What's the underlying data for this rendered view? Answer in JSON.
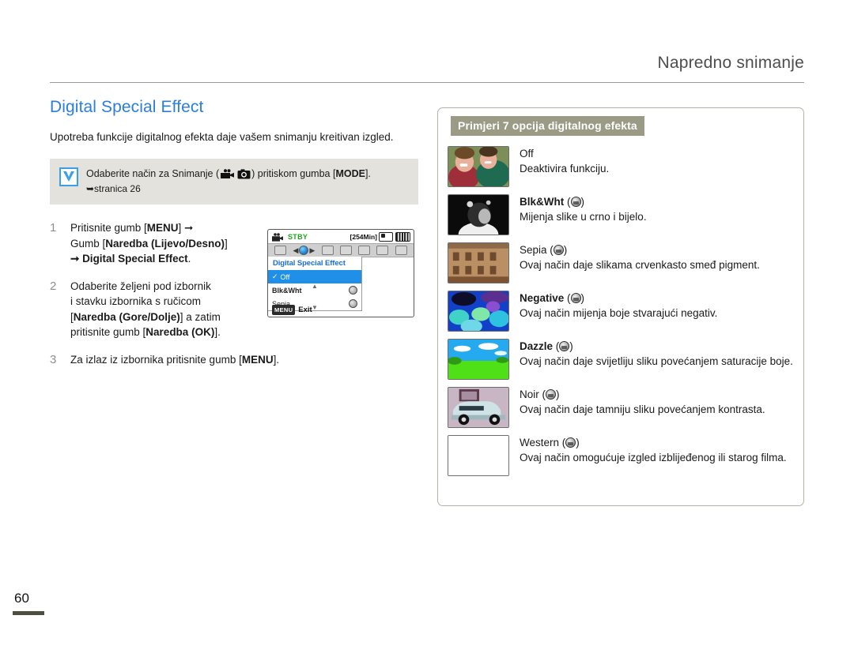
{
  "header": {
    "chapter": "Napredno snimanje"
  },
  "section": {
    "title": "Digital Special Effect",
    "intro": "Upotreba funkcije digitalnog efekta daje vašem snimanju kreitivan izgled."
  },
  "note": {
    "icon": "checkbox-checked-icon",
    "text_before": "Odaberite način za Snimanje (",
    "icon_camcorder": "camcorder-icon",
    "icon_photo": "photo-camera-icon",
    "text_after": ") pritiskom gumba [",
    "button": "MODE",
    "text_end": "].",
    "page_ref": "➥stranica 26"
  },
  "steps": [
    {
      "num": "1",
      "line1_a": "Pritisnite gumb [",
      "line1_b": "MENU",
      "line1_c": "] ➞",
      "line2_a": "Gumb [",
      "line2_b": "Naredba (Lijevo/Desno)",
      "line2_c": "]",
      "line3_a": "➞ ",
      "line3_b": "Digital Special Effect",
      "line3_c": "."
    },
    {
      "num": "2",
      "line1": "Odaberite željeni pod izbornik",
      "line2": "i stavku izbornika s ručicom",
      "line3_a": "[",
      "line3_b": "Naredba (Gore/Dolje)",
      "line3_c": "] a zatim",
      "line4_a": "pritisnite gumb [",
      "line4_b": "Naredba (OK)",
      "line4_c": "]."
    },
    {
      "num": "3",
      "line1_a": "Za izlaz iz izbornika pritisnite gumb [",
      "line1_b": "MENU",
      "line1_c": "]."
    }
  ],
  "lcd": {
    "status": "STBY",
    "remaining": "[254Min]",
    "menu_title": "Digital Special Effect",
    "rows": [
      {
        "label": "Off",
        "selected": true,
        "checked": true,
        "has_icon": false
      },
      {
        "label": "Blk&Wht",
        "selected": false,
        "checked": false,
        "has_icon": true
      },
      {
        "label": "Sepia",
        "selected": false,
        "checked": false,
        "has_icon": true
      }
    ],
    "exit_button": "MENU",
    "exit_label": "Exit",
    "arrow_up": "▲",
    "arrow_down": "▼"
  },
  "panel": {
    "heading": "Primjeri 7 opcija digitalnog efekta",
    "heading_bg": "#9a9a85",
    "effects": [
      {
        "name": "Off",
        "bold": false,
        "has_icon": false,
        "desc": "Deaktivira funkciju.",
        "thumb": "kids-photo"
      },
      {
        "name": "Blk&Wht",
        "bold": true,
        "has_icon": true,
        "desc": "Mijenja slike u crno i bijelo.",
        "thumb": "bw-portrait"
      },
      {
        "name": "Sepia",
        "bold": false,
        "has_icon": true,
        "desc": "Ovaj način daje slikama crvenkasto smeđ pigment.",
        "thumb": "sepia-building"
      },
      {
        "name": "Negative",
        "bold": true,
        "has_icon": true,
        "desc": "Ovaj način mijenja boje stvarajući negativ.",
        "thumb": "negative-flowers"
      },
      {
        "name": "Dazzle",
        "bold": true,
        "has_icon": true,
        "desc": "Ovaj način daje svijetliju sliku povećanjem saturacije boje.",
        "thumb": "dazzle-landscape"
      },
      {
        "name": "Noir",
        "bold": false,
        "has_icon": true,
        "desc": "Ovaj način daje tamniju sliku povećanjem kontrasta.",
        "thumb": "noir-car"
      },
      {
        "name": "Western",
        "bold": false,
        "has_icon": true,
        "desc": "Ovaj način omogućuje izgled izblijeđenog ili starog filma.",
        "thumb": "blank"
      }
    ]
  },
  "footer": {
    "page_number": "60"
  }
}
